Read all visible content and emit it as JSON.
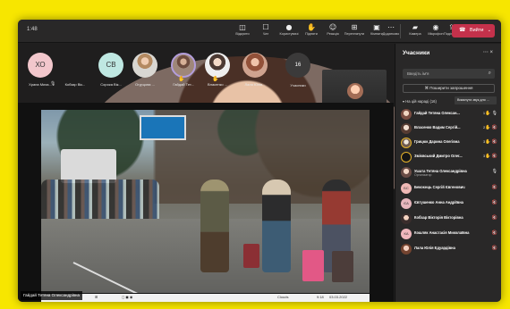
{
  "window": {
    "timer": "1:48"
  },
  "toolbar": [
    {
      "label": "Відкрити",
      "icon": "people-icon"
    },
    {
      "label": "Чат",
      "icon": "chat-icon"
    },
    {
      "label": "Користувачі",
      "icon": "participants-icon"
    },
    {
      "label": "Підняти",
      "icon": "raise-hand-icon"
    },
    {
      "label": "Реакція",
      "icon": "reaction-icon"
    },
    {
      "label": "Переглянути",
      "icon": "view-icon"
    },
    {
      "label": "Кімнати",
      "icon": "rooms-icon"
    },
    {
      "label": "Додатково",
      "icon": "more-icon"
    },
    {
      "label": "Камера",
      "icon": "camera-icon"
    },
    {
      "label": "Мікрофон",
      "icon": "mic-icon"
    },
    {
      "label": "Поділитися",
      "icon": "share-icon"
    }
  ],
  "leave": {
    "label": "Вийти"
  },
  "strip": {
    "tiles": [
      {
        "initials": "ХО",
        "name": "Храпа Миха...",
        "hand": false
      },
      {
        "initials": "",
        "name": "Кобзар Вік...",
        "hand": false
      },
      {
        "initials": "СВ",
        "name": "Сорока Вік...",
        "hand": false
      },
      {
        "initials": "",
        "name": "Огурцова ...",
        "hand": false
      },
      {
        "initials": "",
        "name": "Гайдай Тет...",
        "hand": true
      },
      {
        "initials": "",
        "name": "Власенко ...",
        "hand": true
      },
      {
        "initials": "",
        "name": "Лала Юлія...",
        "hand": false
      }
    ],
    "overflow": {
      "count": "16",
      "label": "Учасники"
    }
  },
  "stage": {
    "caption": "Гайдай Тетяна Олександрівна",
    "taskbar": {
      "weather": "Clouds",
      "time": "9:18",
      "date": "03.03.2022"
    }
  },
  "participants": {
    "title": "Учасники",
    "search_placeholder": "Введіть ім'я",
    "share_label": "Поширити запрошення",
    "section": "На цій нараді (16)",
    "mute_all": "Вимкнути звук для ...",
    "list": [
      {
        "name": "Гайдай Тетяна Олексан...",
        "role": "",
        "status": "1",
        "hand": true
      },
      {
        "name": "Власенко Вадим Сергій...",
        "role": "",
        "status": "2",
        "hand": true
      },
      {
        "name": "Грицюк Дарина Олегівна",
        "role": "",
        "status": "3",
        "hand": true
      },
      {
        "name": "Змієвський Дмитро Олег...",
        "role": "",
        "status": "3",
        "hand": true
      },
      {
        "name": "Ушата Тетяна Олександрівна",
        "role": "Організатор",
        "status": "",
        "hand": false
      },
      {
        "name": "Бекоєнць Сергій Євгенович",
        "role": "",
        "status": "",
        "hand": false
      },
      {
        "name": "Євтушенко Анна Андріївна",
        "role": "",
        "status": "",
        "hand": false
      },
      {
        "name": "Кобзар Вікторія Вікторівна",
        "role": "",
        "status": "",
        "hand": false
      },
      {
        "name": "Кошляк Анастасія Миколаївна",
        "role": "",
        "status": "",
        "hand": false
      },
      {
        "name": "Лала Юлія Едуардівна",
        "role": "",
        "status": "",
        "hand": false
      }
    ]
  }
}
